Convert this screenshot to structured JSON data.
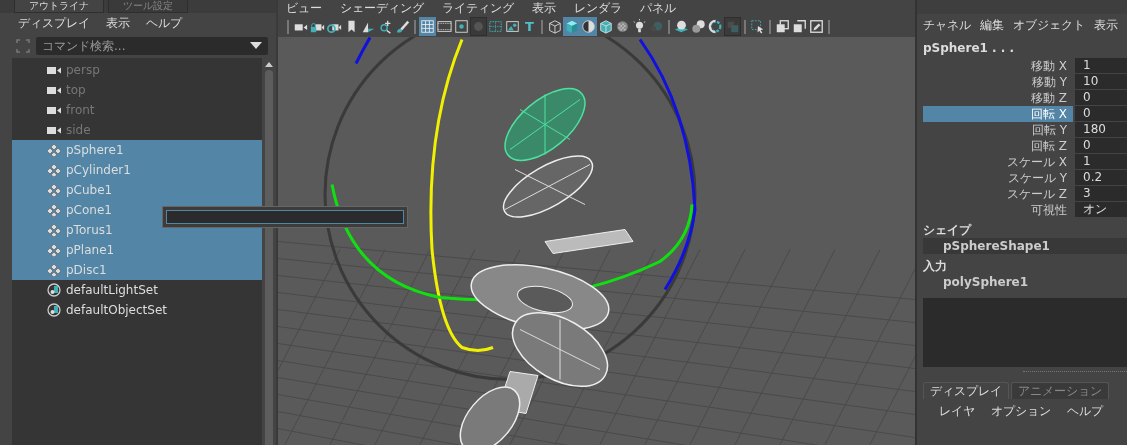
{
  "outliner": {
    "tabs": [
      {
        "label": "アウトライナ",
        "selected": true
      },
      {
        "label": "ツール設定",
        "selected": false
      }
    ],
    "menu": [
      "ディスプレイ",
      "表示",
      "ヘルプ"
    ],
    "search": {
      "placeholder": "コマンド検索..."
    },
    "items": [
      {
        "kind": "camera",
        "label": "persp",
        "selected": false,
        "dimmed": true
      },
      {
        "kind": "camera",
        "label": "top",
        "selected": false,
        "dimmed": true
      },
      {
        "kind": "camera",
        "label": "front",
        "selected": false,
        "dimmed": true
      },
      {
        "kind": "camera",
        "label": "side",
        "selected": false,
        "dimmed": true
      },
      {
        "kind": "mesh",
        "label": "pSphere1",
        "selected": true,
        "dimmed": false
      },
      {
        "kind": "mesh",
        "label": "pCylinder1",
        "selected": true,
        "dimmed": false
      },
      {
        "kind": "mesh",
        "label": "pCube1",
        "selected": true,
        "dimmed": false
      },
      {
        "kind": "mesh",
        "label": "pCone1",
        "selected": true,
        "dimmed": false
      },
      {
        "kind": "mesh",
        "label": "pTorus1",
        "selected": true,
        "dimmed": false
      },
      {
        "kind": "mesh",
        "label": "pPlane1",
        "selected": true,
        "dimmed": false
      },
      {
        "kind": "mesh",
        "label": "pDisc1",
        "selected": true,
        "dimmed": false
      },
      {
        "kind": "set",
        "label": "defaultLightSet",
        "selected": false,
        "dimmed": false
      },
      {
        "kind": "set",
        "label": "defaultObjectSet",
        "selected": false,
        "dimmed": false
      }
    ],
    "rename_field": {
      "open": true
    }
  },
  "viewport": {
    "menu": [
      "ビュー",
      "シェーディング",
      "ライティング",
      "表示",
      "レンダラ",
      "パネル"
    ],
    "toolbar": [
      {
        "kind": "separator"
      },
      {
        "kind": "camera",
        "on": false,
        "pressed": false
      },
      {
        "kind": "camera-lock",
        "on": false,
        "pressed": false
      },
      {
        "kind": "camera-gear",
        "on": false,
        "pressed": false
      },
      {
        "kind": "bookmark",
        "on": false,
        "pressed": false
      },
      {
        "kind": "plane",
        "on": false,
        "pressed": false
      },
      {
        "kind": "pan",
        "on": false,
        "pressed": false
      },
      {
        "kind": "brush",
        "on": false,
        "pressed": false
      },
      {
        "kind": "separator"
      },
      {
        "kind": "grid",
        "on": true,
        "pressed": false
      },
      {
        "kind": "film",
        "on": false,
        "pressed": false
      },
      {
        "kind": "dot",
        "on": false,
        "pressed": false
      },
      {
        "kind": "disc",
        "on": false,
        "pressed": true
      },
      {
        "kind": "field",
        "on": false,
        "pressed": false
      },
      {
        "kind": "picture",
        "on": false,
        "pressed": false
      },
      {
        "kind": "text",
        "on": false,
        "pressed": false,
        "label": "T"
      },
      {
        "kind": "separator"
      },
      {
        "kind": "cube-wire",
        "on": false,
        "pressed": false
      },
      {
        "kind": "cube-shaded",
        "on": true,
        "pressed": false
      },
      {
        "kind": "half-sphere",
        "on": true,
        "pressed": false
      },
      {
        "kind": "cube-textured",
        "on": false,
        "pressed": false
      },
      {
        "kind": "checker",
        "on": false,
        "pressed": false
      },
      {
        "kind": "bulb",
        "on": false,
        "pressed": false
      },
      {
        "kind": "sphere-dim",
        "on": false,
        "pressed": false
      },
      {
        "kind": "separator"
      },
      {
        "kind": "sphere-plane",
        "on": false,
        "pressed": false
      },
      {
        "kind": "spheres",
        "on": false,
        "pressed": false
      },
      {
        "kind": "ring",
        "on": false,
        "pressed": false
      },
      {
        "kind": "square",
        "on": false,
        "pressed": true
      },
      {
        "kind": "separator"
      },
      {
        "kind": "select",
        "on": false,
        "pressed": false
      },
      {
        "kind": "separator"
      },
      {
        "kind": "window-front",
        "on": false,
        "pressed": false
      },
      {
        "kind": "window-back",
        "on": false,
        "pressed": false
      },
      {
        "kind": "window-pen",
        "on": false,
        "pressed": false
      },
      {
        "kind": "separator"
      }
    ]
  },
  "channel_box": {
    "menu": [
      "チャネル",
      "編集",
      "オブジェクト",
      "表示"
    ],
    "object": "pSphere1 . . .",
    "channels": [
      {
        "name": "移動 X",
        "value": "1",
        "selected": false
      },
      {
        "name": "移動 Y",
        "value": "10",
        "selected": false
      },
      {
        "name": "移動 Z",
        "value": "0",
        "selected": false
      },
      {
        "name": "回転 X",
        "value": "0",
        "selected": true
      },
      {
        "name": "回転 Y",
        "value": "180",
        "selected": false
      },
      {
        "name": "回転 Z",
        "value": "0",
        "selected": false
      },
      {
        "name": "スケール X",
        "value": "1",
        "selected": false
      },
      {
        "name": "スケール Y",
        "value": "0.2",
        "selected": false
      },
      {
        "name": "スケール Z",
        "value": "3",
        "selected": false
      },
      {
        "name": "可視性",
        "value": "オン",
        "selected": false
      }
    ],
    "sections": [
      {
        "title": "シェイプ",
        "items": [
          "pSphereShape1"
        ]
      },
      {
        "title": "入力",
        "items": [
          "polySphere1"
        ]
      }
    ]
  },
  "layer_editor": {
    "tabs": [
      {
        "label": "ディスプレイ",
        "selected": true
      },
      {
        "label": "アニメーション",
        "selected": false
      }
    ],
    "menu": [
      "レイヤ",
      "オプション",
      "ヘルプ"
    ]
  }
}
